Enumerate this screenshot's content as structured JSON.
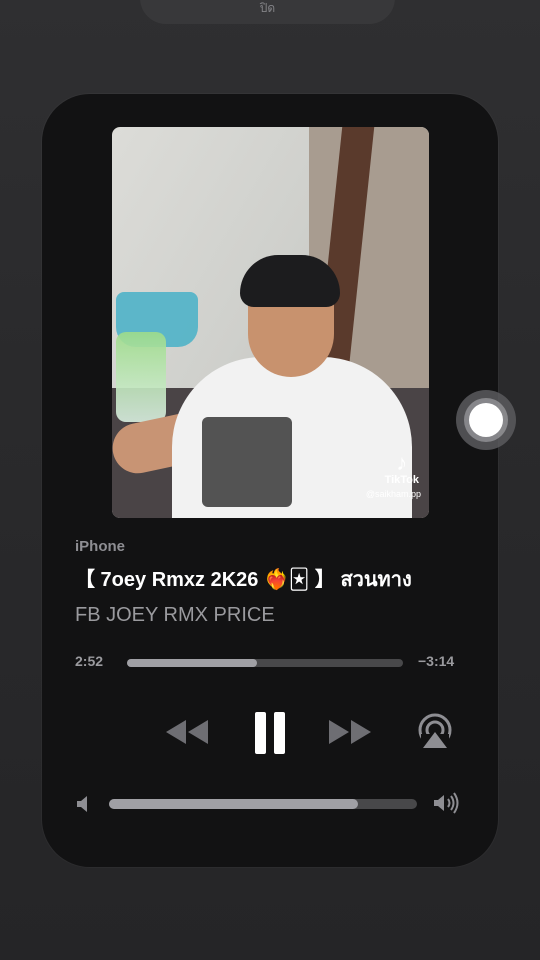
{
  "top_banner": {
    "text": "ปิด"
  },
  "player": {
    "artwork": {
      "watermark_brand": "TikTok",
      "watermark_handle": "@saikham.pp"
    },
    "device": "iPhone",
    "title": "【 7oey Rmxz 2K26 ❤️‍🔥🃏 】 สวนทาง",
    "artist": "FB  JOEY RMX PRICE",
    "time_elapsed": "2:52",
    "time_remaining": "−3:14",
    "progress_fraction": 0.47,
    "volume_fraction": 0.81,
    "controls": {
      "rewind_icon": "rewind-icon",
      "pause_icon": "pause-icon",
      "forward_icon": "fast-forward-icon",
      "airplay_icon": "airplay-icon"
    }
  },
  "colors": {
    "card_bg": "#121213",
    "track_fill": "#a0a0a5",
    "track_bg": "#48484a",
    "secondary_text": "#9a9a9e"
  }
}
